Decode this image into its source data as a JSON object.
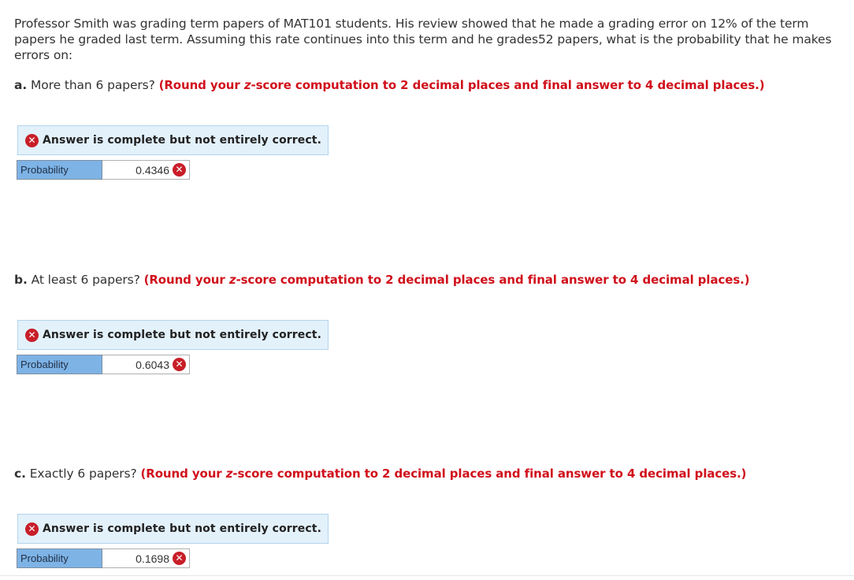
{
  "intro_text": "Professor Smith was grading term papers of MAT101 students. His review showed that he made a grading error on 12% of the term papers he graded last term. Assuming this rate continues into this term and he grades52 papers, what is the probability that he makes errors on:",
  "parts": [
    {
      "letter": "a.",
      "question": "More than 6 papers?",
      "instr_open": "(Round your ",
      "instr_z": "z",
      "instr_rest": "-score computation to 2 decimal places and final answer to 4 decimal places.)",
      "feedback": "Answer is complete but not entirely correct.",
      "label": "Probability",
      "value": "0.4346"
    },
    {
      "letter": "b.",
      "question": "At least 6 papers?",
      "instr_open": "(Round your ",
      "instr_z": "z",
      "instr_rest": "-score computation to 2 decimal places and final answer to 4 decimal places.)",
      "feedback": "Answer is complete but not entirely correct.",
      "label": "Probability",
      "value": "0.6043"
    },
    {
      "letter": "c.",
      "question": "Exactly 6 papers?",
      "instr_open": "(Round your ",
      "instr_z": "z",
      "instr_rest": "-score computation to 2 decimal places and final answer to 4 decimal places.)",
      "feedback": "Answer is complete but not entirely correct.",
      "label": "Probability",
      "value": "0.1698"
    }
  ],
  "icons": {
    "incorrect": "x-circle-icon",
    "incorrect_glyph": "✕"
  },
  "colors": {
    "instruction_red": "#d0101b",
    "incorrect_icon": "#c81e28",
    "feedback_bg": "#e3f1fb",
    "label_bg": "#7eb3e6"
  }
}
